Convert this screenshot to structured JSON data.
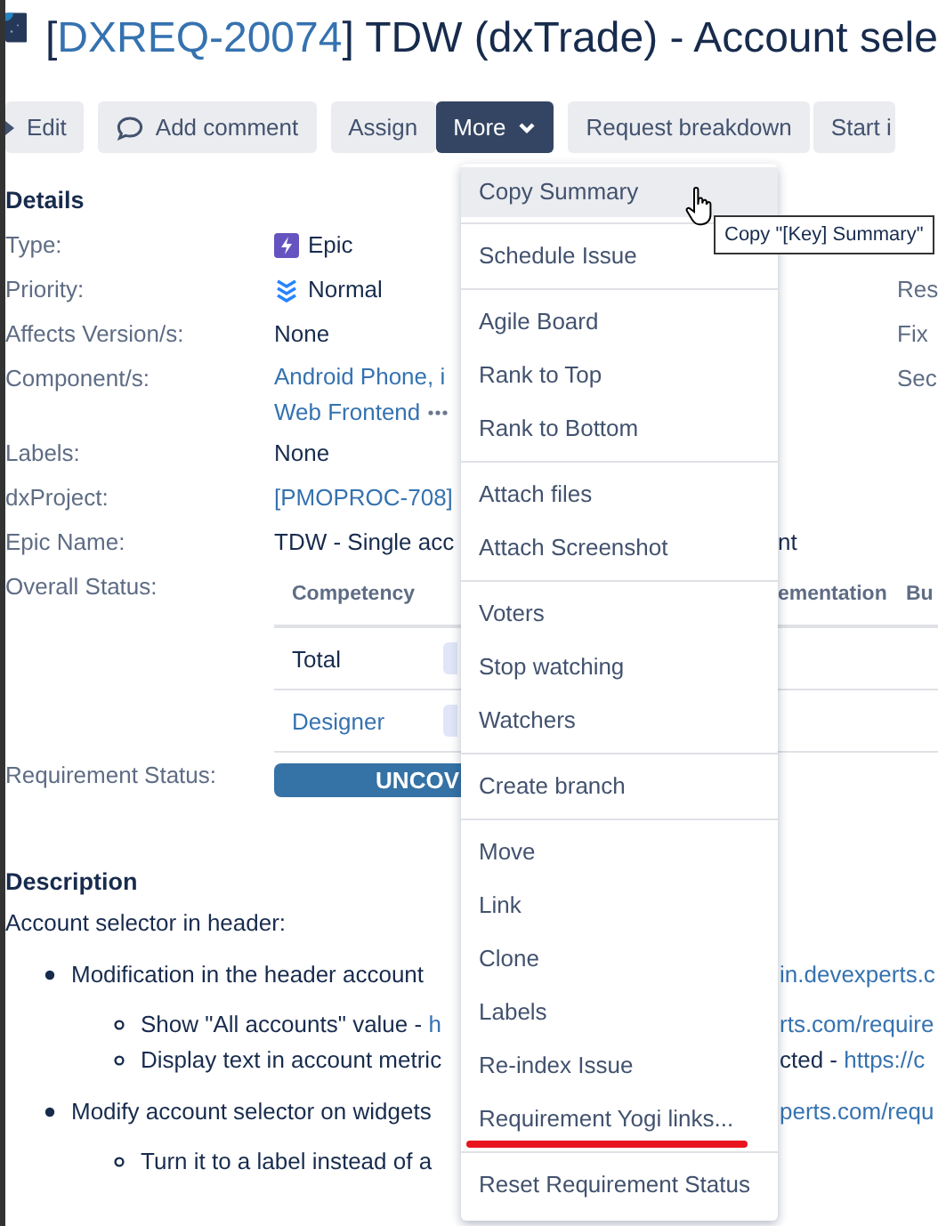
{
  "header": {
    "open": "[",
    "key": "DXREQ-20074",
    "close": "]",
    "summary": "TDW (dxTrade) - Account sele"
  },
  "toolbar": [
    {
      "label": "Edit",
      "kind": "edit",
      "active": false
    },
    {
      "label": "Add comment",
      "kind": "comment",
      "active": false
    },
    {
      "label": "Assign",
      "kind": "plain",
      "active": false
    },
    {
      "label": "More",
      "kind": "dropdown",
      "active": true
    },
    {
      "label": "Request breakdown",
      "kind": "plain",
      "active": false
    },
    {
      "label": "Start i",
      "kind": "plain",
      "active": false
    }
  ],
  "details": {
    "heading": "Details",
    "fields": [
      {
        "label": "Type:",
        "kind": "epic",
        "value": "Epic"
      },
      {
        "label": "Priority:",
        "kind": "priority",
        "value": "Normal",
        "side_label": "Res"
      },
      {
        "label": "Affects Version/s:",
        "kind": "text",
        "value": "None",
        "side_label": "Fix"
      },
      {
        "label": "Component/s:",
        "kind": "links",
        "values": [
          "Android Phone, i",
          "Web Frontend"
        ],
        "side_label": "Sec"
      },
      {
        "label": "Labels:",
        "kind": "text",
        "value": "None"
      },
      {
        "label": "dxProject:",
        "kind": "link",
        "value": "[PMOPROC-708]"
      },
      {
        "label": "Epic Name:",
        "kind": "split",
        "value": "TDW - Single acc",
        "value_tail": "nt"
      },
      {
        "label": "Overall Status:",
        "kind": "table",
        "columns": [
          "Competency",
          "ementation",
          "Bu"
        ],
        "rows": [
          {
            "name": "Total",
            "kind": "text"
          },
          {
            "name": "Designer",
            "kind": "link"
          }
        ]
      },
      {
        "label": "Requirement Status:",
        "kind": "status",
        "value": "UNCOV"
      }
    ]
  },
  "description": {
    "heading": "Description",
    "intro": "Account selector in header:",
    "items": [
      {
        "text": "Modification in the header account ",
        "tail_link": "in.devexperts.c",
        "children": [
          {
            "text": "Show \"All accounts\" value - ",
            "text_link": "h",
            "tail_link": "rts.com/require"
          },
          {
            "text": "Display text in account metric",
            "tail": "cted - ",
            "tail_link": "https://c"
          }
        ]
      },
      {
        "text": "Modify account selector on widgets",
        "tail_link": "perts.com/requ",
        "children": [
          {
            "text": "Turn it to a label instead of a"
          }
        ]
      }
    ]
  },
  "menu": {
    "groups": [
      [
        {
          "label": "Copy Summary",
          "highlighted": true
        }
      ],
      [
        {
          "label": "Schedule Issue",
          "highlighted": false
        }
      ],
      [
        {
          "label": "Agile Board",
          "highlighted": false
        },
        {
          "label": "Rank to Top",
          "highlighted": false
        },
        {
          "label": "Rank to Bottom",
          "highlighted": false
        }
      ],
      [
        {
          "label": "Attach files",
          "highlighted": false
        },
        {
          "label": "Attach Screenshot",
          "highlighted": false
        }
      ],
      [
        {
          "label": "Voters",
          "highlighted": false
        },
        {
          "label": "Stop watching",
          "highlighted": false
        },
        {
          "label": "Watchers",
          "highlighted": false
        }
      ],
      [
        {
          "label": "Create branch",
          "highlighted": false
        }
      ],
      [
        {
          "label": "Move",
          "highlighted": false
        },
        {
          "label": "Link",
          "highlighted": false
        },
        {
          "label": "Clone",
          "highlighted": false
        },
        {
          "label": "Labels",
          "highlighted": false
        },
        {
          "label": "Re-index Issue",
          "highlighted": false
        },
        {
          "label": "Requirement Yogi links...",
          "highlighted": false,
          "underlined": true
        }
      ],
      [
        {
          "label": "Reset Requirement Status",
          "highlighted": false
        }
      ]
    ]
  },
  "tooltip": "Copy \"[Key] Summary\""
}
